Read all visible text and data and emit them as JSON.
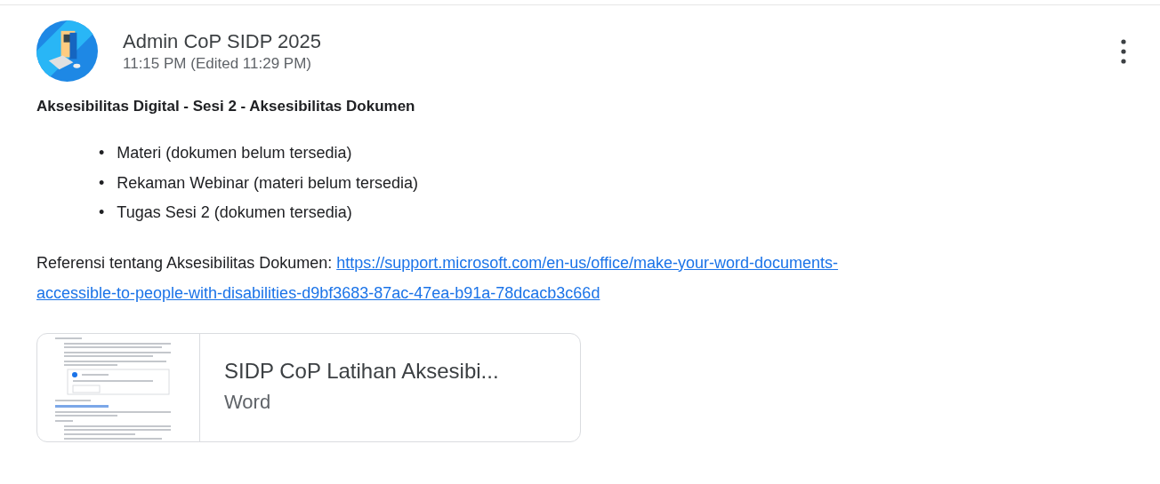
{
  "post": {
    "author": "Admin CoP SIDP 2025",
    "timestamp": "11:15 PM (Edited 11:29 PM)",
    "title": "Aksesibilitas Digital - Sesi 2 - Aksesibilitas Dokumen",
    "items": [
      {
        "bullet": "•",
        "text": "Materi (dokumen belum tersedia)"
      },
      {
        "bullet": "•",
        "text": "Rekaman Webinar (materi belum tersedia)"
      },
      {
        "bullet": "•",
        "text": "Tugas Sesi 2 (dokumen tersedia)"
      }
    ],
    "reference_label": "Referensi tentang Aksesibilitas Dokumen:",
    "reference_link_lines": [
      "https://support.microsoft.com/en-us/office/make-your-word-documents-",
      "accessible-to-people-with-disabilities-d9bf3683-87ac-47ea-b91a-78dcacb3c66d"
    ],
    "attachment": {
      "title": "SIDP CoP Latihan Aksesibi...",
      "type": "Word"
    }
  }
}
